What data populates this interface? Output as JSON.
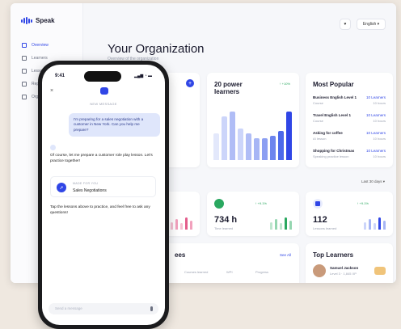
{
  "app": {
    "name": "Speak"
  },
  "sidebar": {
    "items": [
      {
        "label": "Overview",
        "active": true
      },
      {
        "label": "Learners"
      },
      {
        "label": "Lessons"
      },
      {
        "label": "Reports"
      },
      {
        "label": "Org"
      }
    ]
  },
  "header": {
    "language": "English",
    "title": "Your Organization",
    "subtitle": "Overview of the organization"
  },
  "power_learners": {
    "title": "20 power learners",
    "delta": "↑ +10%",
    "bar_values": [
      55,
      90,
      100,
      65,
      55,
      45,
      45,
      50,
      60,
      100
    ],
    "bar_colors": [
      "#e3e8fb",
      "#ccd5fa",
      "#b0bdf6",
      "#ccd5fa",
      "#b0bdf6",
      "#a7b6f5",
      "#8c9ff2",
      "#6d85ee",
      "#4c69ea",
      "#3046e6"
    ]
  },
  "most_popular": {
    "title": "Most Popular",
    "rows": [
      {
        "name": "Business English Level 1",
        "category": "Course",
        "count": "10 Learners",
        "hours": "10 hours"
      },
      {
        "name": "Travel English Level 1",
        "category": "Course",
        "count": "10 Learners",
        "hours": "10 hours"
      },
      {
        "name": "Asking for coffee",
        "category": "AI lesson",
        "count": "10 Learners",
        "hours": "10 hours"
      },
      {
        "name": "Shopping for Christmas",
        "category": "Speaking practice lesson",
        "count": "10 Learners",
        "hours": "10 hours"
      }
    ]
  },
  "filter": {
    "range": "Last 30 days"
  },
  "stats": [
    {
      "value": "",
      "label": "",
      "delta": "↑ +9.1%"
    },
    {
      "value": "734 h",
      "label": "Time learned",
      "delta": "↑ +9.1%"
    },
    {
      "value": "112",
      "label": "Lessons learned",
      "delta": "↑ +9.1%"
    }
  ],
  "employees": {
    "title": "ees",
    "see_all": "See All",
    "columns": [
      "Courses learned",
      "WPI",
      "Progress"
    ]
  },
  "top_learners": {
    "title": "Top Learners",
    "name": "Samuel Jackson",
    "meta": "Level 3 · 1,845 XP"
  },
  "chat": {
    "status_time": "9:41",
    "status_icons": "▂▄▆ ◔ ▬",
    "close_glyph": "×",
    "new_message": "NEW MESSAGE",
    "user_message": "I'm preparing for a sales negotiation with a customer in New York. Can you help me prepare?",
    "bot_reply": "Of course, let me prepare a customer role play lesson. Let's practice together!",
    "made_for_you": "MADE FOR YOU",
    "lesson_title": "Sales Negotiations",
    "tap_message": "Tap the lessons above to practice, and feel free to ask any questions!",
    "input_placeholder": "Send a message"
  },
  "colors": {
    "accent": "#3046e6",
    "green": "#2aa860",
    "pink": "#e35d8c"
  }
}
